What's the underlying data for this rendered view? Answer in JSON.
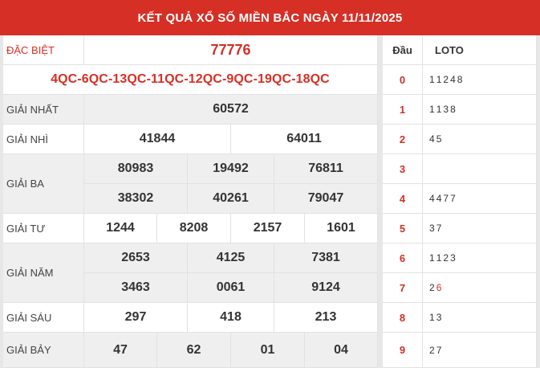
{
  "header": {
    "title": "KẾT QUẢ XỔ SỐ MIỀN BẮC NGÀY 11/11/2025"
  },
  "results": {
    "special": {
      "label": "ĐẶC BIỆT",
      "value": "77776"
    },
    "codes": "4QC-6QC-13QC-11QC-12QC-9QC-19QC-18QC",
    "first": {
      "label": "GIẢI NHẤT",
      "values": [
        "60572"
      ]
    },
    "second": {
      "label": "GIẢI NHÌ",
      "values": [
        "41844",
        "64011"
      ]
    },
    "third": {
      "label": "GIẢI BA",
      "values": [
        "80983",
        "19492",
        "76811",
        "38302",
        "40261",
        "79047"
      ]
    },
    "fourth": {
      "label": "GIẢI TƯ",
      "values": [
        "1244",
        "8208",
        "2157",
        "1601"
      ]
    },
    "fifth": {
      "label": "GIẢI NĂM",
      "values": [
        "2653",
        "4125",
        "7381",
        "3463",
        "0061",
        "9124"
      ]
    },
    "sixth": {
      "label": "GIẢI SÁU",
      "values": [
        "297",
        "418",
        "213"
      ]
    },
    "seventh": {
      "label": "GIẢI BẢY",
      "values": [
        "47",
        "62",
        "01",
        "04"
      ]
    }
  },
  "loto": {
    "head_label": "Đầu",
    "loto_label": "LOTO",
    "rows": [
      {
        "head": "0",
        "tails": [
          "1",
          "1",
          "2",
          "4",
          "8"
        ]
      },
      {
        "head": "1",
        "tails": [
          "1",
          "1",
          "3",
          "8"
        ]
      },
      {
        "head": "2",
        "tails": [
          "4",
          "5"
        ]
      },
      {
        "head": "3",
        "tails": []
      },
      {
        "head": "4",
        "tails": [
          "4",
          "4",
          "7",
          "7"
        ]
      },
      {
        "head": "5",
        "tails": [
          "3",
          "7"
        ]
      },
      {
        "head": "6",
        "tails": [
          "1",
          "1",
          "2",
          "3"
        ]
      },
      {
        "head": "7",
        "tails": [
          "2",
          "6"
        ],
        "highlight": [
          "6"
        ]
      },
      {
        "head": "8",
        "tails": [
          "1",
          "3"
        ]
      },
      {
        "head": "9",
        "tails": [
          "2",
          "7"
        ]
      }
    ]
  },
  "colors": {
    "brand_red": "#d62f25",
    "row_shade": "#efefef"
  }
}
